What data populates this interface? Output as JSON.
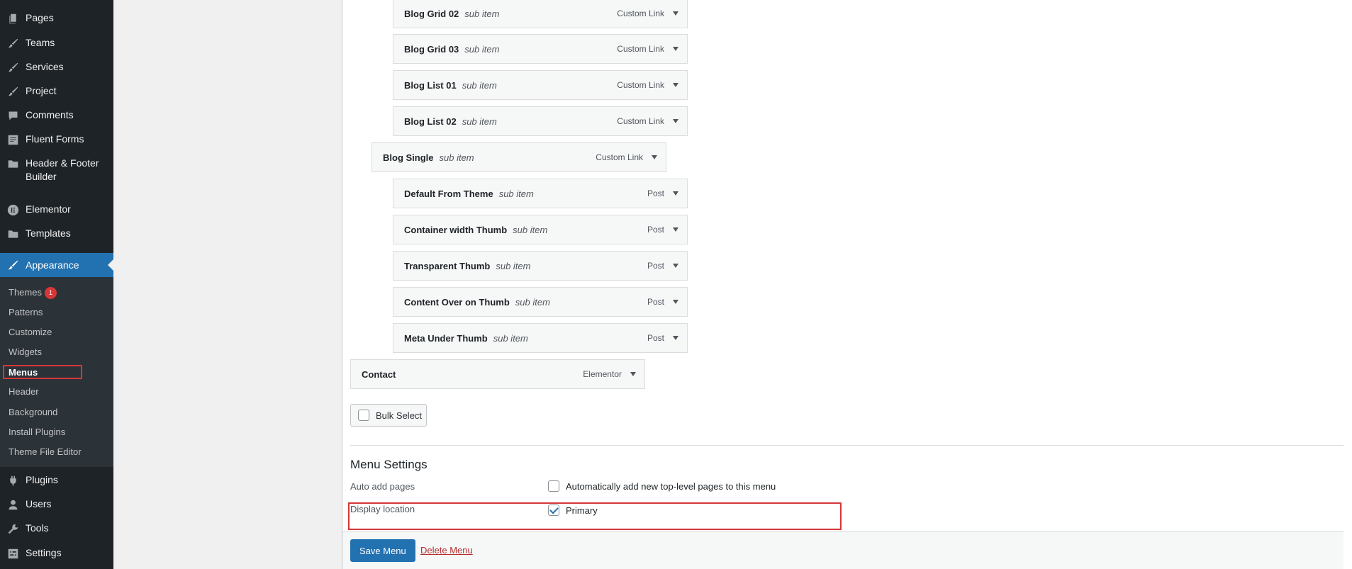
{
  "sidebar": {
    "items": [
      {
        "label": "Pages",
        "icon": "pages-icon"
      },
      {
        "label": "Teams",
        "icon": "brush-icon"
      },
      {
        "label": "Services",
        "icon": "brush-icon"
      },
      {
        "label": "Project",
        "icon": "brush-icon"
      },
      {
        "label": "Comments",
        "icon": "comment-icon"
      },
      {
        "label": "Fluent Forms",
        "icon": "form-icon"
      },
      {
        "label": "Header & Footer Builder",
        "icon": "folder-icon"
      },
      {
        "label": "Elementor",
        "icon": "elementor-icon"
      },
      {
        "label": "Templates",
        "icon": "folder-icon"
      }
    ],
    "appearance": {
      "label": "Appearance"
    },
    "submenu": [
      {
        "label": "Themes",
        "badge": "1"
      },
      {
        "label": "Patterns"
      },
      {
        "label": "Customize"
      },
      {
        "label": "Widgets"
      },
      {
        "label": "Menus"
      },
      {
        "label": "Header"
      },
      {
        "label": "Background"
      },
      {
        "label": "Install Plugins"
      },
      {
        "label": "Theme File Editor"
      }
    ],
    "bottom_items": [
      {
        "label": "Plugins"
      },
      {
        "label": "Users"
      },
      {
        "label": "Tools"
      },
      {
        "label": "Settings"
      }
    ]
  },
  "menu_items": [
    {
      "title": "Blog Grid 02",
      "sub": "sub item",
      "type": "Custom Link"
    },
    {
      "title": "Blog Grid 03",
      "sub": "sub item",
      "type": "Custom Link"
    },
    {
      "title": "Blog List 01",
      "sub": "sub item",
      "type": "Custom Link"
    },
    {
      "title": "Blog List 02",
      "sub": "sub item",
      "type": "Custom Link"
    },
    {
      "title": "Blog Single",
      "sub": "sub item",
      "type": "Custom Link"
    },
    {
      "title": "Default From Theme",
      "sub": "sub item",
      "type": "Post"
    },
    {
      "title": "Container width Thumb",
      "sub": "sub item",
      "type": "Post"
    },
    {
      "title": "Transparent Thumb",
      "sub": "sub item",
      "type": "Post"
    },
    {
      "title": "Content Over on Thumb",
      "sub": "sub item",
      "type": "Post"
    },
    {
      "title": "Meta Under Thumb",
      "sub": "sub item",
      "type": "Post"
    },
    {
      "title": "Contact",
      "sub": "",
      "type": "Elementor"
    }
  ],
  "bulk_select": "Bulk Select",
  "settings": {
    "title": "Menu Settings",
    "auto_add_label": "Auto add pages",
    "auto_add_option": "Automatically add new top-level pages to this menu",
    "display_location_label": "Display location",
    "primary_option": "Primary"
  },
  "footer": {
    "save": "Save Menu",
    "delete": "Delete Menu"
  }
}
